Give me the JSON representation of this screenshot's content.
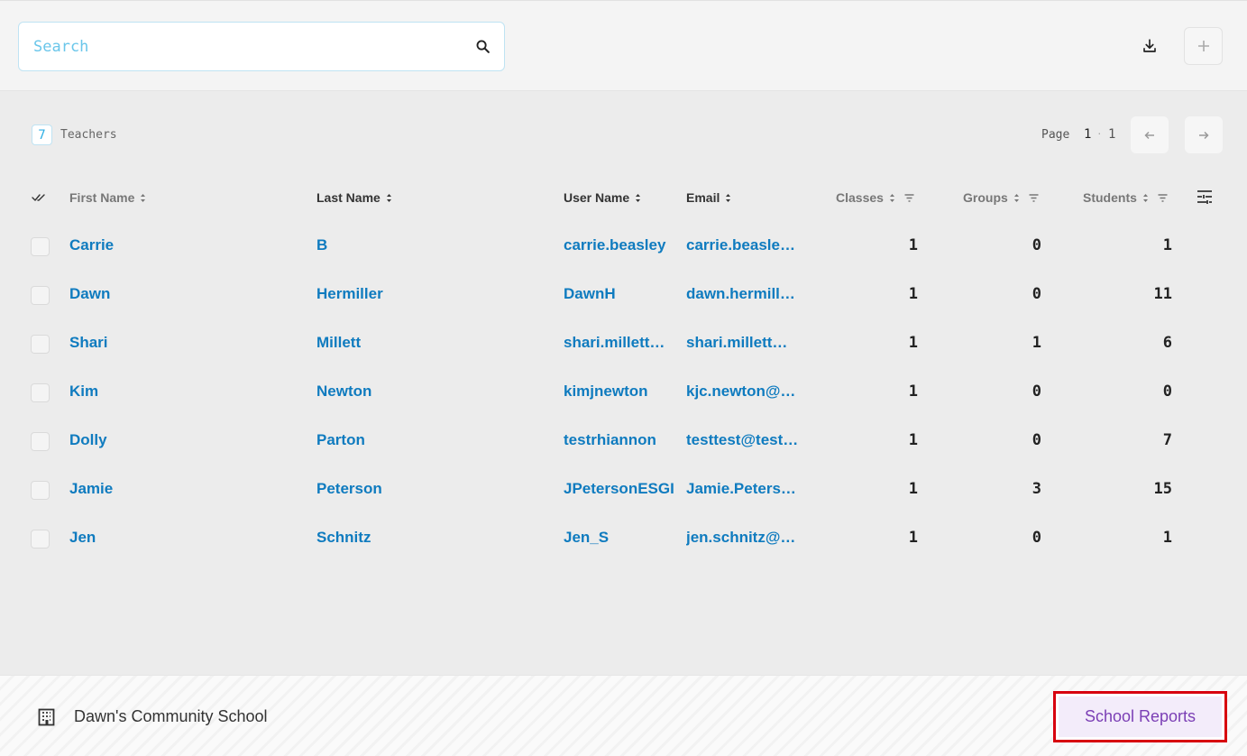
{
  "search": {
    "placeholder": "Search"
  },
  "toolbar": {
    "download_icon": "download-icon",
    "add_icon": "plus-icon"
  },
  "summary": {
    "count": "7",
    "label": "Teachers"
  },
  "pagination": {
    "label": "Page",
    "current": "1",
    "separator": "·",
    "total": "1"
  },
  "columns": {
    "first_name": "First Name",
    "last_name": "Last Name",
    "user_name": "User Name",
    "email": "Email",
    "classes": "Classes",
    "groups": "Groups",
    "students": "Students"
  },
  "rows": [
    {
      "first": "Carrie",
      "last": "B",
      "user": "carrie.beasley",
      "email": "carrie.beasle…",
      "classes": "1",
      "groups": "0",
      "students": "1"
    },
    {
      "first": "Dawn",
      "last": "Hermiller",
      "user": "DawnH",
      "email": "dawn.hermill…",
      "classes": "1",
      "groups": "0",
      "students": "11"
    },
    {
      "first": "Shari",
      "last": "Millett",
      "user": "shari.millett…",
      "email": "shari.millett…",
      "classes": "1",
      "groups": "1",
      "students": "6"
    },
    {
      "first": "Kim",
      "last": "Newton",
      "user": "kimjnewton",
      "email": "kjc.newton@…",
      "classes": "1",
      "groups": "0",
      "students": "0"
    },
    {
      "first": "Dolly",
      "last": "Parton",
      "user": "testrhiannon",
      "email": "testtest@test…",
      "classes": "1",
      "groups": "0",
      "students": "7"
    },
    {
      "first": "Jamie",
      "last": "Peterson",
      "user": "JPetersonESGI",
      "email": "Jamie.Peters…",
      "classes": "1",
      "groups": "3",
      "students": "15"
    },
    {
      "first": "Jen",
      "last": "Schnitz",
      "user": "Jen_S",
      "email": "jen.schnitz@…",
      "classes": "1",
      "groups": "0",
      "students": "1"
    }
  ],
  "footer": {
    "school_name": "Dawn's Community School",
    "reports_button": "School Reports"
  },
  "colors": {
    "link": "#0f7bbf",
    "accent": "#2eaee4",
    "reports_text": "#7b3fb5",
    "highlight": "#d7000f"
  }
}
